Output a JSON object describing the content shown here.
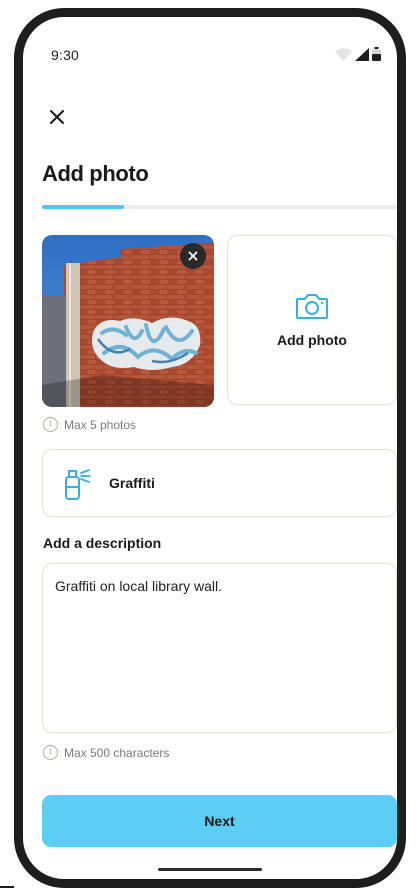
{
  "status_bar": {
    "time": "9:30",
    "icons": [
      "wifi-icon",
      "cellular-signal-icon",
      "battery-icon"
    ]
  },
  "header": {
    "close_icon": "close-icon",
    "title": "Add photo",
    "progress_fraction": 0.23
  },
  "photos": {
    "thumbnail": {
      "subject": "brick wall with graffiti",
      "remove_icon": "close-icon"
    },
    "add_card": {
      "icon": "camera-icon",
      "label": "Add photo"
    },
    "hint": "Max 5 photos"
  },
  "category": {
    "icon": "spray-can-icon",
    "label": "Graffiti"
  },
  "description": {
    "label": "Add a description",
    "value": "Graffiti on local library wall.",
    "hint": "Max 500 characters"
  },
  "actions": {
    "next_label": "Next"
  },
  "colors": {
    "accent": "#5ccdf5",
    "progress": "#4cc7f2",
    "card_border": "#e6dfd4",
    "text": "#1a1a1a",
    "hint_text": "#7a7a7a"
  }
}
